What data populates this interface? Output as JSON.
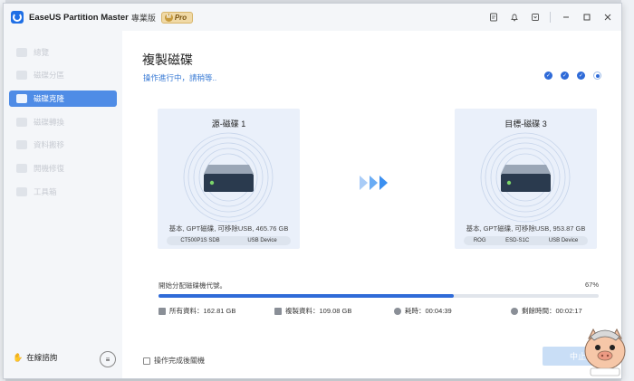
{
  "app": {
    "title": "EaseUS Partition Master",
    "edition": "專業版",
    "badge": "Pro"
  },
  "sidebar": {
    "items": [
      {
        "label": "總覽",
        "active": false
      },
      {
        "label": "磁碟分區",
        "active": false
      },
      {
        "label": "磁碟克隆",
        "active": true
      },
      {
        "label": "磁碟轉換",
        "active": false
      },
      {
        "label": "資料搬移",
        "active": false
      },
      {
        "label": "開機修復",
        "active": false
      },
      {
        "label": "工具箱",
        "active": false
      }
    ],
    "help_label": "在線諮詢"
  },
  "main": {
    "title": "複製磁碟",
    "status": "操作進行中，請稍等..",
    "steps_done": 3,
    "steps_total": 4,
    "source": {
      "title": "源-磁碟 1",
      "info": "基本, GPT磁碟, 可移除USB, 465.76 GB",
      "tags": [
        "CT500P1S SDB",
        "USB Device"
      ]
    },
    "target": {
      "title": "目標-磁碟 3",
      "info": "基本, GPT磁碟, 可移除USB, 953.87 GB",
      "tags": [
        "ROG",
        "ESD-S1C",
        "USB Device"
      ]
    },
    "progress": {
      "label": "開始分配磁碟機代號。",
      "percent_text": "67%",
      "percent": 67
    },
    "stats": {
      "total": "所有資料：162.81 GB",
      "copied": "複製資料：109.08 GB",
      "elapsed": "耗時：00:04:39",
      "remaining": "剩餘時間：00:02:17"
    },
    "shutdown_label": "操作完成後關機",
    "cancel_label": "中止"
  },
  "colors": {
    "accent": "#2f6bd8",
    "sidebar_active": "#4f8ce6",
    "card_bg": "#eaf0fa"
  }
}
